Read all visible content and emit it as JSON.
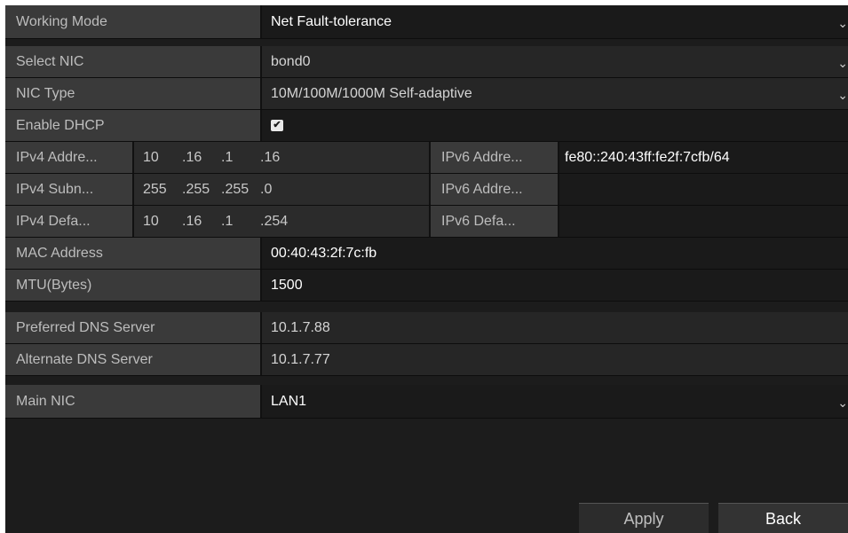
{
  "working_mode": {
    "label": "Working Mode",
    "value": "Net Fault-tolerance"
  },
  "select_nic": {
    "label": "Select NIC",
    "value": "bond0"
  },
  "nic_type": {
    "label": "NIC Type",
    "value": "10M/100M/1000M Self-adaptive"
  },
  "enable_dhcp": {
    "label": "Enable DHCP",
    "checked": true,
    "check_glyph": "✔"
  },
  "ipv4_address": {
    "label": "IPv4 Addre...",
    "segments": [
      "10",
      ".16",
      ".1",
      ".16"
    ]
  },
  "ipv4_subnet": {
    "label": "IPv4 Subn...",
    "segments": [
      "255",
      ".255",
      ".255",
      ".0"
    ]
  },
  "ipv4_gateway": {
    "label": "IPv4 Defa...",
    "segments": [
      "10",
      ".16",
      ".1",
      ".254"
    ]
  },
  "ipv6_address1": {
    "label": "IPv6 Addre...",
    "value": "fe80::240:43ff:fe2f:7cfb/64"
  },
  "ipv6_address2": {
    "label": "IPv6 Addre...",
    "value": ""
  },
  "ipv6_gateway": {
    "label": "IPv6 Defa...",
    "value": ""
  },
  "mac_address": {
    "label": "MAC Address",
    "value": "00:40:43:2f:7c:fb"
  },
  "mtu": {
    "label": "MTU(Bytes)",
    "value": "1500"
  },
  "preferred_dns": {
    "label": "Preferred DNS Server",
    "value": "10.1.7.88"
  },
  "alternate_dns": {
    "label": "Alternate DNS Server",
    "value": "10.1.7.77"
  },
  "main_nic": {
    "label": "Main NIC",
    "value": "LAN1"
  },
  "icons": {
    "dropdown": "chevron-down-icon",
    "chevron_glyph": "⌄"
  },
  "buttons": {
    "apply": "Apply",
    "back": "Back"
  },
  "colors": {
    "background": "#1c1c1c",
    "label_bg": "#3a3a3a",
    "text": "#ffffff"
  }
}
